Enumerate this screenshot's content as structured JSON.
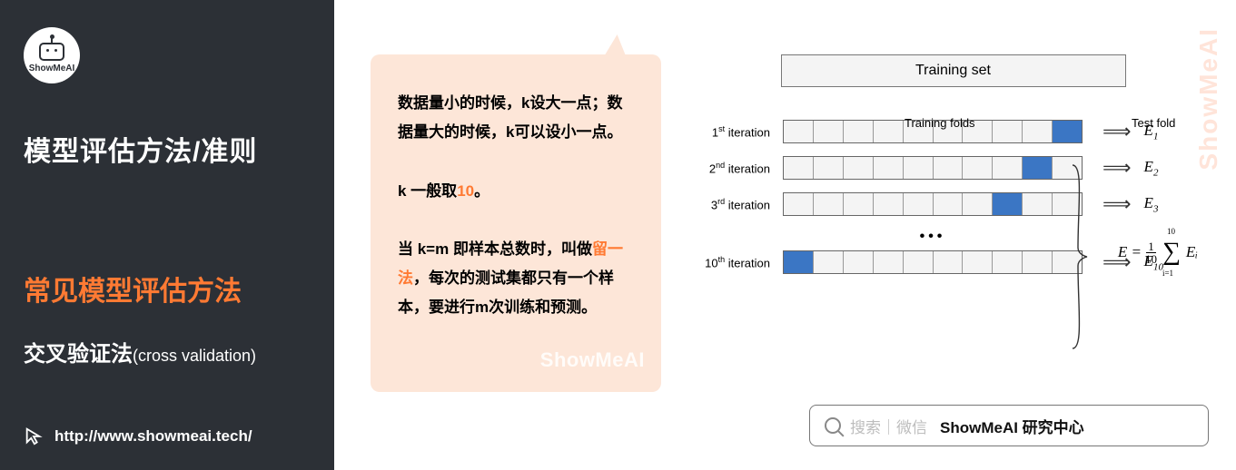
{
  "sidebar": {
    "logo_text": "ShowMeAI",
    "heading_main": "模型评估方法/准则",
    "heading_sub": "常见模型评估方法",
    "heading_detail": "交叉验证法",
    "heading_detail_paren": "(cross validation)",
    "url": "http://www.showmeai.tech/"
  },
  "bubble": {
    "p1": "数据量小的时候，k设大一点；数据量大的时候，k可以设小一点。",
    "p2_prefix": "k 一般取",
    "p2_orange": "10",
    "p2_suffix": "。",
    "p3_prefix": "当 k=m 即样本总数时，叫做",
    "p3_orange": "留一法",
    "p3_suffix": "，每次的测试集都只有一个样本，要进行m次训练和预测。",
    "watermark": "ShowMeAI"
  },
  "diagram": {
    "training_set": "Training set",
    "label_training_folds": "Training folds",
    "label_test_fold": "Test fold",
    "dots": "•••",
    "formula_lhs": "E = ",
    "formula_frac_num": "1",
    "formula_frac_den": "10",
    "formula_sum_top": "10",
    "formula_sum_bot": "i=1",
    "formula_rhs": "Eᵢ",
    "rows": [
      {
        "label_pre": "1",
        "label_sup": "st",
        "label_post": " iteration",
        "test_index": 9,
        "e": "1"
      },
      {
        "label_pre": "2",
        "label_sup": "nd",
        "label_post": " iteration",
        "test_index": 8,
        "e": "2"
      },
      {
        "label_pre": "3",
        "label_sup": "rd",
        "label_post": " iteration",
        "test_index": 7,
        "e": "3"
      },
      {
        "label_pre": "10",
        "label_sup": "th",
        "label_post": " iteration",
        "test_index": 0,
        "e": "10"
      }
    ]
  },
  "search": {
    "hint": "搜索｜微信",
    "strong": "ShowMeAI 研究中心"
  },
  "watermark_side": "ShowMeAI"
}
